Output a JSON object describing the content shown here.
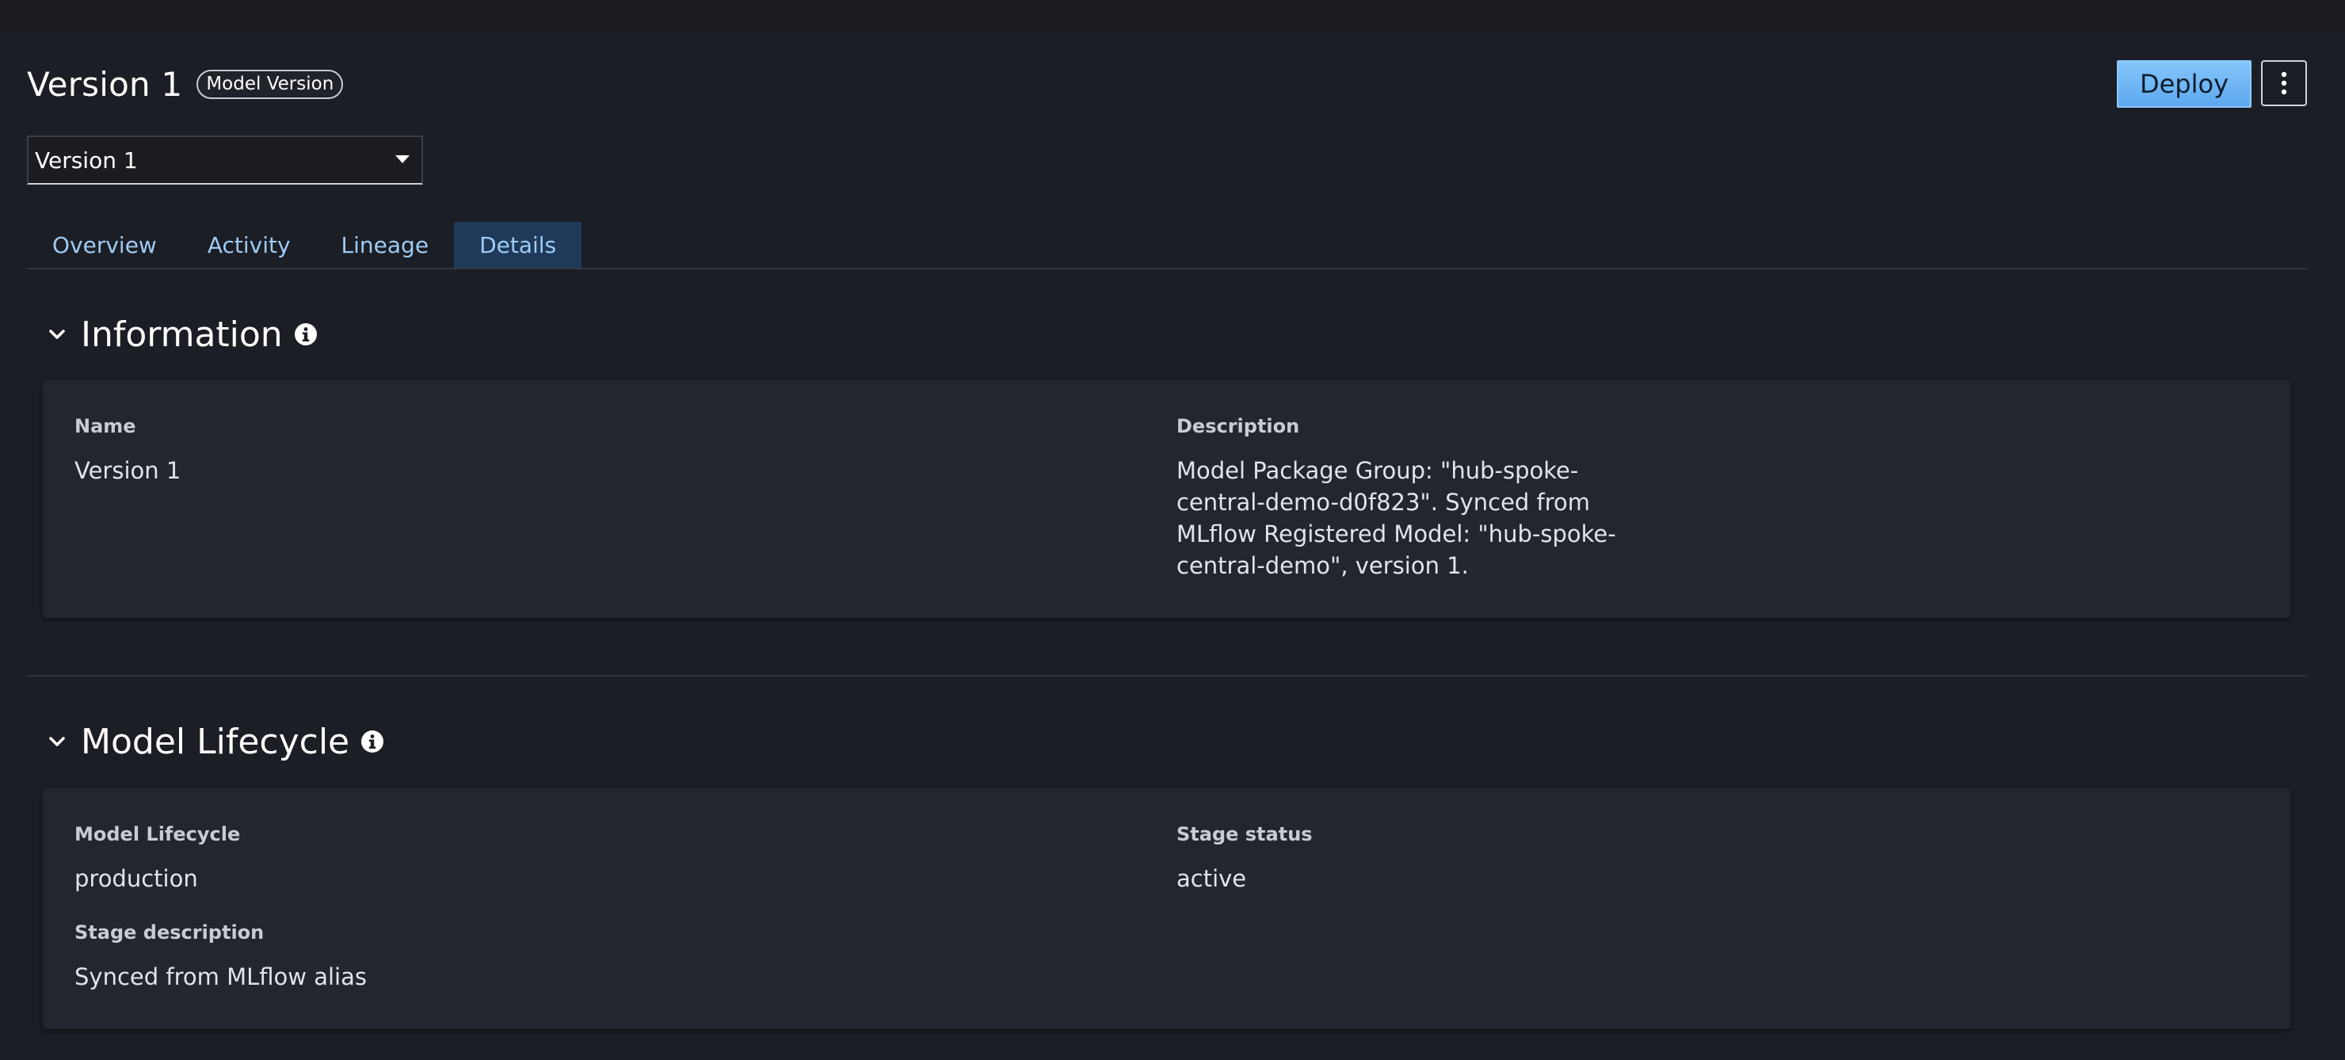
{
  "header": {
    "title": "Version 1",
    "badge": "Model Version",
    "deploy_label": "Deploy",
    "more_icon": "more-vertical-icon"
  },
  "version_select": {
    "value": "Version 1",
    "icon": "caret-down-icon"
  },
  "tabs": [
    {
      "label": "Overview",
      "active": false
    },
    {
      "label": "Activity",
      "active": false
    },
    {
      "label": "Lineage",
      "active": false
    },
    {
      "label": "Details",
      "active": true
    }
  ],
  "information": {
    "title": "Information",
    "name_label": "Name",
    "name_value": "Version 1",
    "description_label": "Description",
    "description_value": "Model Package Group: \"hub-spoke-central-demo-d0f823\". Synced from MLflow Registered Model: \"hub-spoke-central-demo\", version 1."
  },
  "lifecycle": {
    "title": "Model Lifecycle",
    "lifecycle_label": "Model Lifecycle",
    "lifecycle_value": "production",
    "stage_status_label": "Stage status",
    "stage_status_value": "active",
    "stage_description_label": "Stage description",
    "stage_description_value": "Synced from MLflow alias"
  },
  "colors": {
    "background": "#1c1e25",
    "card": "#23262e",
    "primary_button": "#6eb6f5",
    "tab_text": "#9ecbf5",
    "active_tab_bg": "#1f3a59"
  }
}
